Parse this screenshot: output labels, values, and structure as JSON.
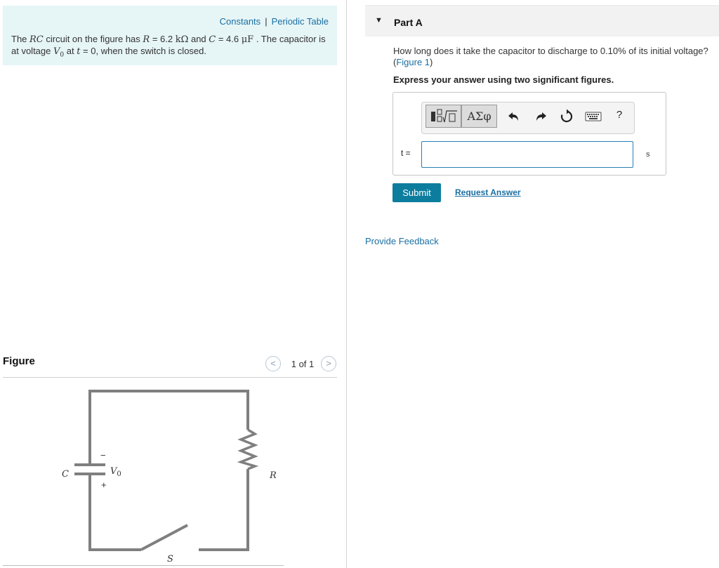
{
  "problem": {
    "links": [
      "Constants",
      "Periodic Table"
    ],
    "separator": "|",
    "text": {
      "p1": "The ",
      "rc": "RC",
      "p2": " circuit on the figure has ",
      "r_sym": "R",
      "p3": " = 6.2 ",
      "r_unit": "kΩ",
      "p4": " and ",
      "c_sym": "C",
      "p5": " = 4.6 ",
      "c_unit": "μF",
      "p6": " . The capacitor is at voltage ",
      "v0_sym": "V",
      "v0_sub": "0",
      "p7": " at ",
      "t_sym": "t",
      "p8": " = 0, when the switch is closed."
    }
  },
  "figure": {
    "title": "Figure",
    "pager": {
      "prev": "<",
      "next": ">",
      "count": "1 of 1"
    },
    "labels": {
      "c": "C",
      "v": "V",
      "v_sub": "0",
      "r": "R",
      "s": "S",
      "minus": "−",
      "plus": "+"
    }
  },
  "part": {
    "toggle_icon": "▼",
    "title": "Part A",
    "question": "How long does it take the capacitor to discharge to 0.10% of its initial voltage?",
    "figure_ref_open": "(",
    "figure_ref": "Figure 1",
    "figure_ref_close": ")",
    "instruction": "Express your answer using two significant figures.",
    "toolbar": {
      "greek_label": "ΑΣφ",
      "icons": [
        "templates-icon",
        "greek-symbols-icon",
        "undo-icon",
        "redo-icon",
        "reset-icon",
        "keyboard-icon",
        "help-icon"
      ],
      "help_label": "?"
    },
    "input": {
      "label": "t =",
      "value": "",
      "unit": "s"
    },
    "submit_label": "Submit",
    "request_answer_label": "Request Answer"
  },
  "feedback_label": "Provide Feedback",
  "colors": {
    "accent": "#0d7d9e",
    "link": "#1a6fa3",
    "problem_bg": "#e6f5f6"
  }
}
